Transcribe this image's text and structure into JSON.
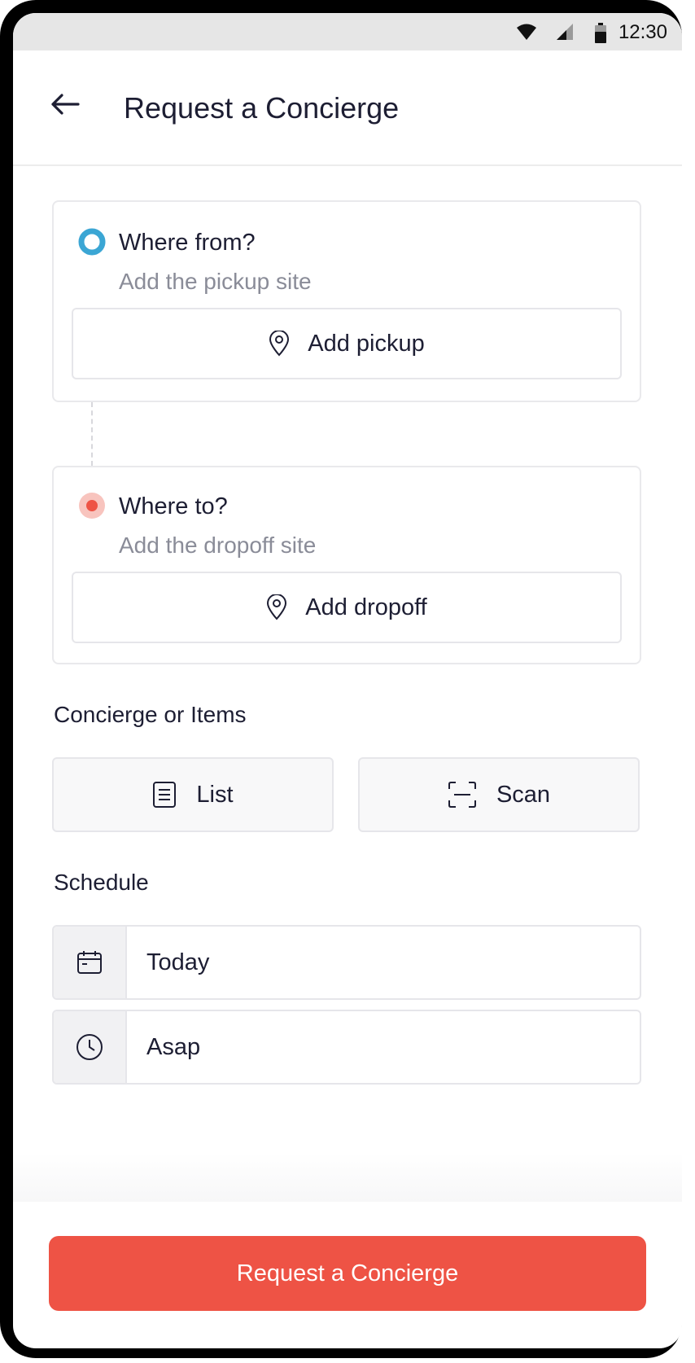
{
  "status_bar": {
    "time": "12:30",
    "icons": [
      "wifi-icon",
      "signal-icon",
      "battery-icon"
    ]
  },
  "header": {
    "back_icon": "arrow-left-icon",
    "title": "Request a Concierge"
  },
  "pickup": {
    "heading": "Where from?",
    "subtitle": "Add the pickup site",
    "button_label": "Add pickup",
    "dot_color": "#3ba6d4"
  },
  "dropoff": {
    "heading": "Where to?",
    "subtitle": "Add the dropoff site",
    "button_label": "Add dropoff",
    "dot_color": "#ee5345"
  },
  "items_section": {
    "label": "Concierge or Items",
    "list_label": "List",
    "scan_label": "Scan"
  },
  "schedule": {
    "label": "Schedule",
    "date_value": "Today",
    "time_value": "Asap"
  },
  "cta": {
    "label": "Request a Concierge",
    "color": "#ee5345"
  }
}
